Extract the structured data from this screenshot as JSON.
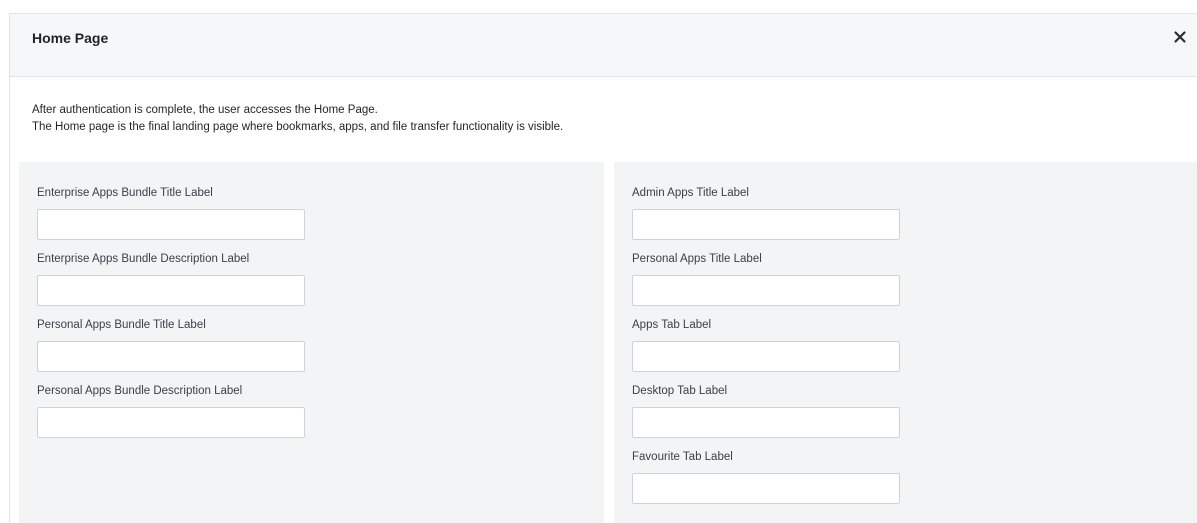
{
  "dialog": {
    "title": "Home Page",
    "close_icon": "close-icon"
  },
  "intro": {
    "line1": "After authentication is complete, the user accesses the Home Page.",
    "line2": "The Home page is the final landing page where bookmarks, apps, and file transfer functionality is visible."
  },
  "left_fields": [
    {
      "label": "Enterprise Apps Bundle Title Label",
      "value": ""
    },
    {
      "label": "Enterprise Apps Bundle Description Label",
      "value": ""
    },
    {
      "label": "Personal Apps Bundle Title Label",
      "value": ""
    },
    {
      "label": "Personal Apps Bundle Description Label",
      "value": ""
    }
  ],
  "right_fields": [
    {
      "label": "Admin Apps Title Label",
      "value": ""
    },
    {
      "label": "Personal Apps Title Label",
      "value": ""
    },
    {
      "label": "Apps Tab Label",
      "value": ""
    },
    {
      "label": "Desktop Tab Label",
      "value": ""
    },
    {
      "label": "Favourite Tab Label",
      "value": ""
    }
  ]
}
